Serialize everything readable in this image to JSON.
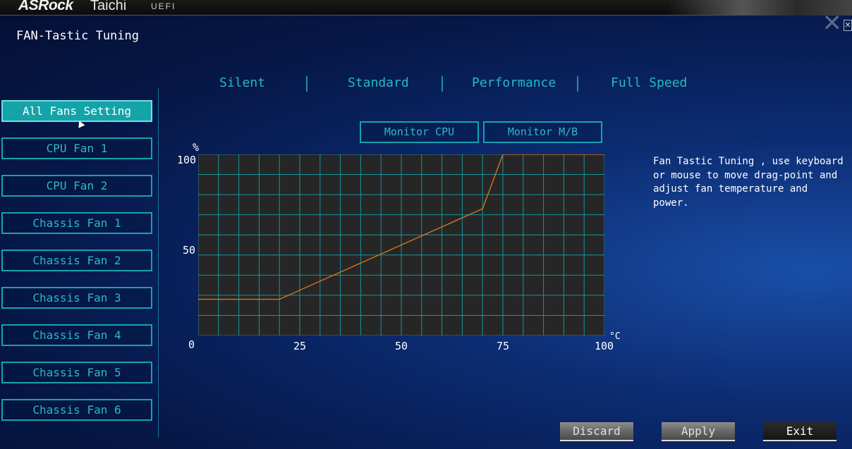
{
  "header": {
    "brand": "ASRock",
    "model": "Taichi",
    "firmware": "UEFI"
  },
  "page": {
    "title": "FAN-Tastic Tuning"
  },
  "presets": [
    "Silent",
    "Standard",
    "Performance",
    "Full Speed"
  ],
  "sidebar": {
    "selected": "All Fans Setting",
    "items": [
      {
        "label": "All Fans Setting"
      },
      {
        "label": "CPU Fan 1"
      },
      {
        "label": "CPU Fan 2"
      },
      {
        "label": "Chassis Fan 1"
      },
      {
        "label": "Chassis Fan 2"
      },
      {
        "label": "Chassis Fan 3"
      },
      {
        "label": "Chassis Fan 4"
      },
      {
        "label": "Chassis Fan 5"
      },
      {
        "label": "Chassis Fan 6"
      }
    ]
  },
  "monitor": {
    "cpu": "Monitor CPU",
    "mb": "Monitor M/B"
  },
  "chart_data": {
    "type": "line",
    "ylabel": "%",
    "xlabel": "°C",
    "xlim": [
      0,
      100
    ],
    "ylim": [
      0,
      100
    ],
    "xticks": [
      "0",
      "25",
      "50",
      "75",
      "100"
    ],
    "yticks": [
      "100",
      "50"
    ],
    "grid": true,
    "series": [
      {
        "x": [
          0,
          20,
          70,
          75,
          100
        ],
        "y": [
          20,
          20,
          70,
          100,
          100
        ]
      }
    ],
    "colors": {
      "line": "#d9731c",
      "grid": "#16959e",
      "bg": "#262626",
      "border": "#3a7a8a"
    }
  },
  "description": "Fan Tastic Tuning , use keyboard\nor mouse to move drag-point and\nadjust fan temperature and power.",
  "buttons": {
    "discard": "Discard",
    "apply": "Apply",
    "exit": "Exit"
  },
  "icons": {
    "close": "close-icon",
    "cursor": "mouse-cursor-icon"
  }
}
